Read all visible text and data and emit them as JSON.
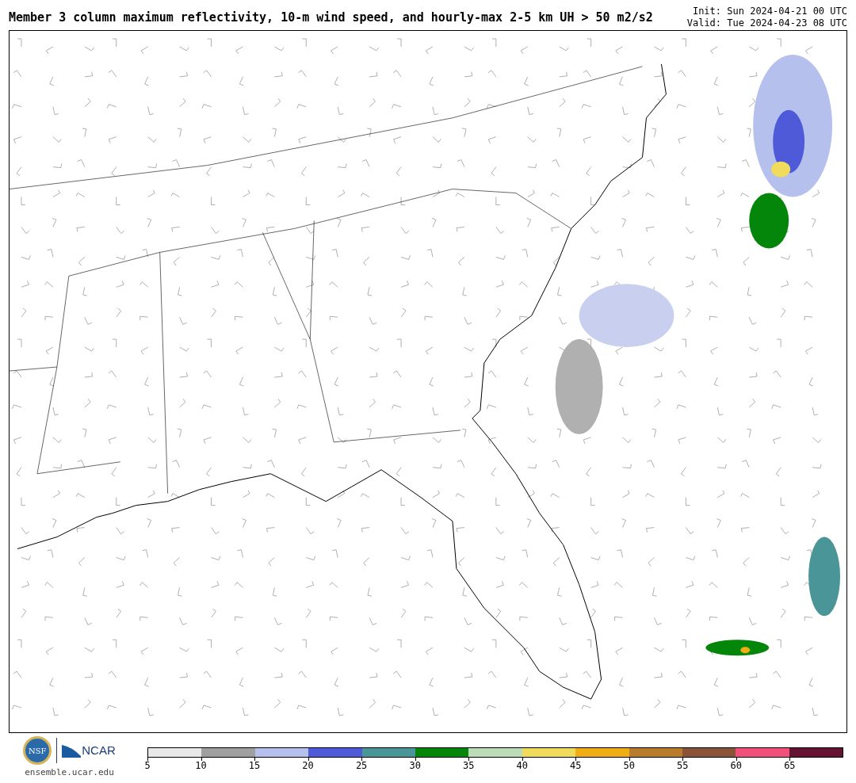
{
  "title": "Member 3 column maximum reflectivity, 10-m wind speed, and hourly-max 2-5 km UH > 50 m2/s2",
  "init": "Init: Sun 2024-04-21 00 UTC",
  "valid": "Valid: Tue 2024-04-23 08 UTC",
  "footer": {
    "nsf_logo": "NSF",
    "ncar_logo": "NCAR",
    "url": "ensemble.ucar.edu"
  },
  "colorbar": [
    {
      "label": "5",
      "color": "#e8e8e8"
    },
    {
      "label": "10",
      "color": "#a0a0a0"
    },
    {
      "label": "15",
      "color": "#b6c0ec"
    },
    {
      "label": "20",
      "color": "#4e5ad8"
    },
    {
      "label": "25",
      "color": "#4a9598"
    },
    {
      "label": "30",
      "color": "#04860a"
    },
    {
      "label": "35",
      "color": "#bcdcb8"
    },
    {
      "label": "40",
      "color": "#f0dc5a"
    },
    {
      "label": "45",
      "color": "#f0ae14"
    },
    {
      "label": "50",
      "color": "#b87c2a"
    },
    {
      "label": "55",
      "color": "#8a5438"
    },
    {
      "label": "60",
      "color": "#f0507a"
    },
    {
      "label": "65",
      "color": "#641432"
    }
  ]
}
